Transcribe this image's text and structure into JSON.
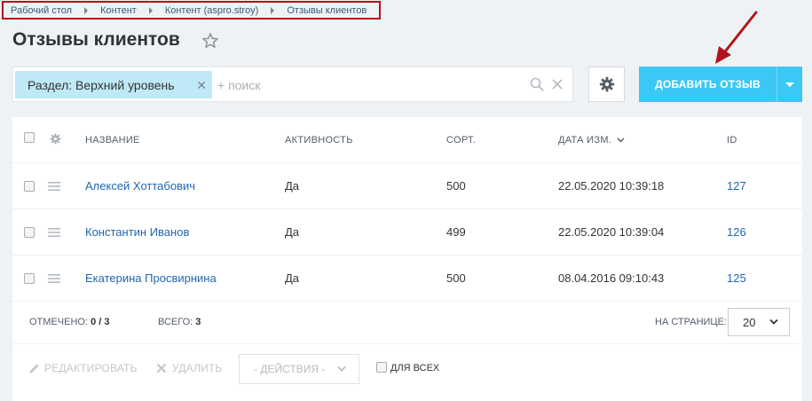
{
  "breadcrumb": [
    "Рабочий стол",
    "Контент",
    "Контент (aspro.stroy)",
    "Отзывы клиентов"
  ],
  "page_title": "Отзывы клиентов",
  "filter": {
    "tag_label": "Раздел: Верхний уровень",
    "search_placeholder": "+ поиск"
  },
  "toolbar": {
    "add_label": "ДОБАВИТЬ ОТЗЫВ"
  },
  "grid": {
    "columns": [
      "НАЗВАНИЕ",
      "АКТИВНОСТЬ",
      "СОРТ.",
      "ДАТА ИЗМ.",
      "ID"
    ],
    "rows": [
      {
        "name": "Алексей Хоттабович",
        "active": "Да",
        "sort": "500",
        "date": "22.05.2020 10:39:18",
        "id": "127"
      },
      {
        "name": "Константин Иванов",
        "active": "Да",
        "sort": "499",
        "date": "22.05.2020 10:39:04",
        "id": "126"
      },
      {
        "name": "Екатерина Просвирнина",
        "active": "Да",
        "sort": "500",
        "date": "08.04.2016 09:10:43",
        "id": "125"
      }
    ]
  },
  "footer": {
    "selected_label": "ОТМЕЧЕНО:",
    "selected_value": "0 / 3",
    "total_label": "ВСЕГО:",
    "total_value": "3",
    "per_page_label": "НА СТРАНИЦЕ:",
    "per_page_value": "20"
  },
  "actions": {
    "edit_label": "РЕДАКТИРОВАТЬ",
    "delete_label": "УДАЛИТЬ",
    "actions_select": "- ДЕЙСТВИЯ -",
    "for_all_label": "ДЛЯ ВСЕХ"
  },
  "colors": {
    "accent": "#3bc8f5",
    "link": "#2067b0",
    "highlight": "#b0141b"
  }
}
